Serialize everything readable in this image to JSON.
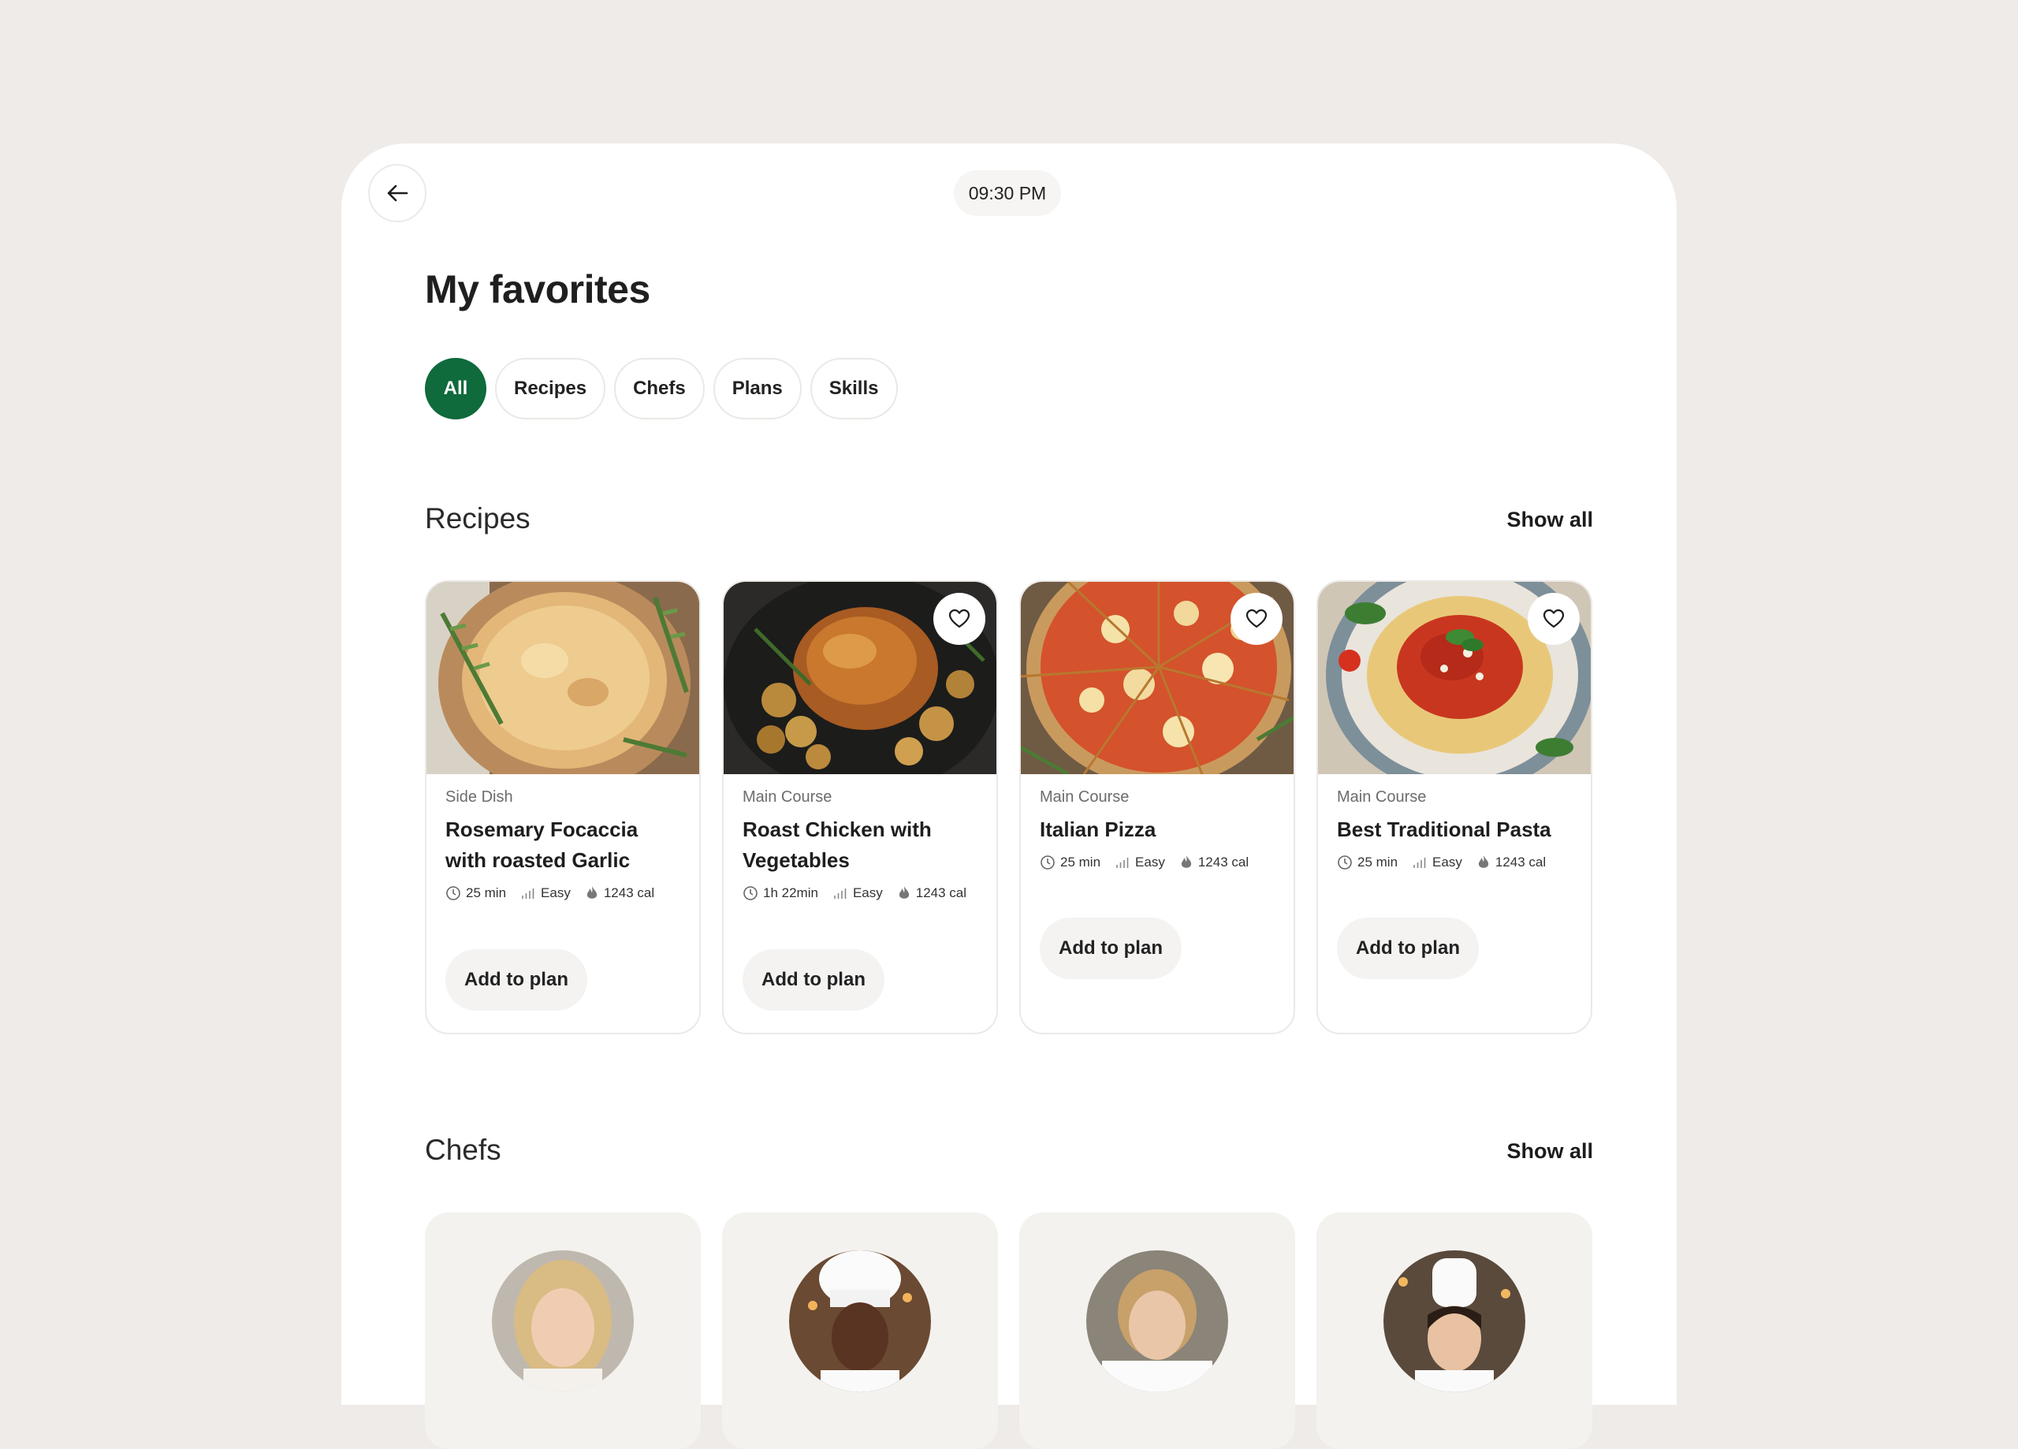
{
  "status": {
    "time": "09:30 PM"
  },
  "page": {
    "title": "My favorites"
  },
  "filters": [
    "All",
    "Recipes",
    "Chefs",
    "Plans",
    "Skills"
  ],
  "recipes_section": {
    "title": "Recipes",
    "show_all": "Show all",
    "items": [
      {
        "category": "Side Dish",
        "title": "Rosemary Focaccia with roasted Garlic",
        "time": "25 min",
        "difficulty": "Easy",
        "calories": "1243 cal",
        "action": "Add to plan",
        "favorite_button": false
      },
      {
        "category": "Main Course",
        "title": "Roast Chicken with Vegetables",
        "time": "1h 22min",
        "difficulty": "Easy",
        "calories": "1243 cal",
        "action": "Add to plan",
        "favorite_button": true
      },
      {
        "category": "Main Course",
        "title": "Italian Pizza",
        "time": "25 min",
        "difficulty": "Easy",
        "calories": "1243 cal",
        "action": "Add to plan",
        "favorite_button": true
      },
      {
        "category": "Main Course",
        "title": "Best Traditional Pasta",
        "time": "25 min",
        "difficulty": "Easy",
        "calories": "1243 cal",
        "action": "Add to plan",
        "favorite_button": true
      }
    ]
  },
  "chefs_section": {
    "title": "Chefs",
    "show_all": "Show all"
  },
  "colors": {
    "accent": "#0f6a3c",
    "background": "#efebe8",
    "chip_border": "#ebe8e5",
    "chef_card": "#f4f2ef"
  },
  "icons": [
    "arrow-left-icon",
    "heart-icon",
    "clock-icon",
    "bar-chart-icon",
    "flame-icon"
  ]
}
